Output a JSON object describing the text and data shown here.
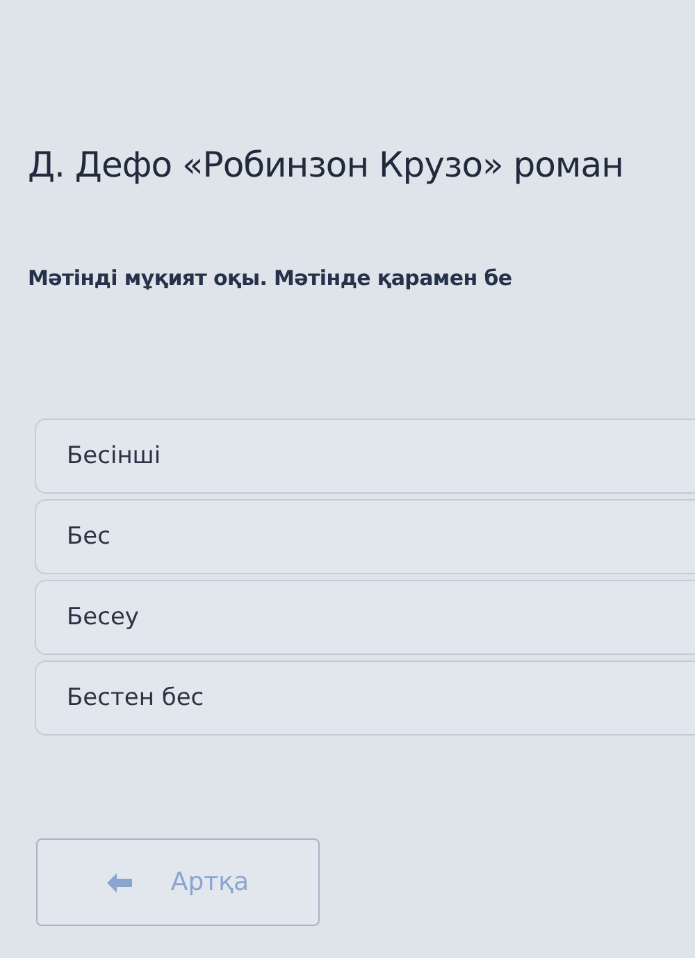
{
  "title": "Д. Дефо «Робинзон Крузо» роман",
  "instruction": "Мәтінді мұқият оқы. Мәтінде қарамен бе",
  "options": [
    {
      "label": "Бесінші",
      "selected": false
    },
    {
      "label": "Бес",
      "selected": false
    },
    {
      "label": "Бесеу",
      "selected": false
    },
    {
      "label": "Бестен бес",
      "selected": false
    }
  ],
  "back_button": {
    "label": "Артқа",
    "disabled": true
  }
}
